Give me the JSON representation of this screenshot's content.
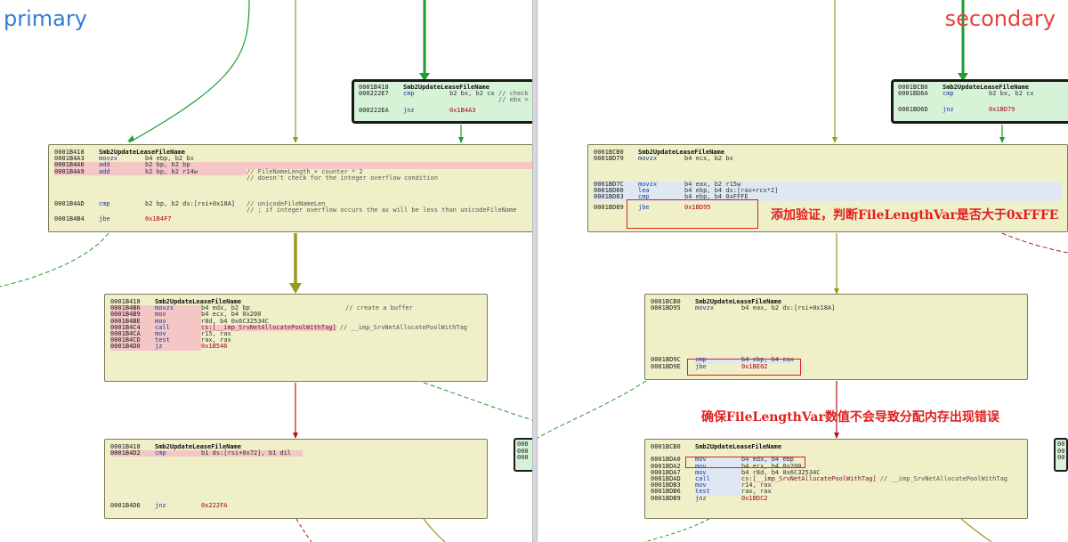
{
  "labels": {
    "primary": "primary",
    "secondary": "secondary"
  },
  "primary": {
    "block_top": {
      "header_addr": "0001B418",
      "header_name": "Smb2UpdateLeaseFileName",
      "rows": [
        {
          "addr": "000222E7",
          "mn": "cmp",
          "ops": "b2 bx, b2 cx",
          "cm": "// check"
        },
        {
          "addr": "",
          "mn": "",
          "ops": "",
          "cm": "// ebx ="
        },
        {
          "addr": "000222EA",
          "mn": "jnz",
          "ops": "0x1B4A3",
          "cm": ""
        }
      ]
    },
    "block_a": {
      "header_addr": "0001B418",
      "header_name": "Smb2UpdateLeaseFileName",
      "rows": [
        {
          "addr": "0001B4A3",
          "mn": "movzx",
          "ops": "b4 ebp, b2 bx",
          "cm": ""
        },
        {
          "addr": "0001B4A6",
          "mn": "add",
          "ops": "b2 bp, b2 bp",
          "cm": ""
        },
        {
          "addr": "0001B4A9",
          "mn": "add",
          "ops": "b2 bp, b2 r14w",
          "cm": "// FileNameLength + counter * 2"
        },
        {
          "addr": "",
          "mn": "",
          "ops": "",
          "cm": "// doesn't check for the integer overflow condition"
        },
        {
          "addr": "0001B4AD",
          "mn": "cmp",
          "ops": "b2 bp, b2 ds:[rsi+0x18A]",
          "cm": "// unicodeFileNameLen"
        },
        {
          "addr": "",
          "mn": "",
          "ops": "",
          "cm": "// ; if integer overflow occurs the ax will be less than unicodeFileName"
        },
        {
          "addr": "0001B4B4",
          "mn": "jbe",
          "ops": "0x1B4F7",
          "cm": ""
        }
      ]
    },
    "block_b": {
      "header_addr": "0001B418",
      "header_name": "Smb2UpdateLeaseFileName",
      "rows": [
        {
          "addr": "0001B4B6",
          "mn": "movzx",
          "ops": "b4 edx, b2 bp",
          "cm": "// create a buffer"
        },
        {
          "addr": "0001B4B9",
          "mn": "mov",
          "ops": "b4 ecx, b4 0x200",
          "cm": ""
        },
        {
          "addr": "0001B4BE",
          "mn": "mov",
          "ops": "r8d, b4 0x6C32534C",
          "cm": ""
        },
        {
          "addr": "0001B4C4",
          "mn": "call",
          "ops": "cs:[__imp_SrvNetAllocatePoolWithTag]",
          "cm": "// __imp_SrvNetAllocatePoolWithTag"
        },
        {
          "addr": "0001B4CA",
          "mn": "mov",
          "ops": "r15, rax",
          "cm": ""
        },
        {
          "addr": "0001B4CD",
          "mn": "test",
          "ops": "rax, rax",
          "cm": ""
        },
        {
          "addr": "0001B4D0",
          "mn": "jz",
          "ops": "0x1B546",
          "cm": ""
        }
      ]
    },
    "block_c": {
      "header_addr": "0001B418",
      "header_name": "Smb2UpdateLeaseFileName",
      "rows": [
        {
          "addr": "0001B4D2",
          "mn": "cmp",
          "ops": "b1 ds:[rsi+0x72], b1 dil",
          "cm": ""
        },
        {
          "addr": "0001B4D6",
          "mn": "jnz",
          "ops": "0x222FA",
          "cm": ""
        }
      ]
    },
    "side_block": {
      "line1": "000",
      "line2": "000",
      "line3": "000"
    }
  },
  "secondary": {
    "block_top": {
      "header_addr": "0001BCB0",
      "header_name": "Smb2UpdateLeaseFileName",
      "rows": [
        {
          "addr": "0001BD6A",
          "mn": "cmp",
          "ops": "b2 bx, b2 cx",
          "cm": ""
        },
        {
          "addr": "0001BD6D",
          "mn": "jnz",
          "ops": "0x1BD79",
          "cm": ""
        }
      ]
    },
    "block_a": {
      "header_addr": "0001BCB0",
      "header_name": "Smb2UpdateLeaseFileName",
      "rows": [
        {
          "addr": "0001BD79",
          "mn": "movzx",
          "ops": "b4 ecx, b2 bx",
          "cm": ""
        },
        {
          "addr": "0001BD7C",
          "mn": "movzx",
          "ops": "b4 eax, b2 r15w",
          "cm": ""
        },
        {
          "addr": "0001BD80",
          "mn": "lea",
          "ops": "b4 ebp, b4 ds:[rax+rcx*2]",
          "cm": ""
        },
        {
          "addr": "0001BD83",
          "mn": "cmp",
          "ops": "b4 ebp, b4 0xFFFE",
          "cm": ""
        },
        {
          "addr": "0001BD89",
          "mn": "jbe",
          "ops": "0x1BD95",
          "cm": ""
        }
      ]
    },
    "block_b": {
      "header_addr": "0001BCB0",
      "header_name": "Smb2UpdateLeaseFileName",
      "rows": [
        {
          "addr": "0001BD95",
          "mn": "movzx",
          "ops": "b4 eax, b2 ds:[rsi+0x18A]",
          "cm": ""
        },
        {
          "addr": "0001BD9C",
          "mn": "cmp",
          "ops": "b4 ebp, b4 eax",
          "cm": ""
        },
        {
          "addr": "0001BD9E",
          "mn": "jbe",
          "ops": "0x1BE02",
          "cm": ""
        }
      ]
    },
    "block_c": {
      "header_addr": "0001BCB0",
      "header_name": "Smb2UpdateLeaseFileName",
      "rows": [
        {
          "addr": "0001BDA0",
          "mn": "mov",
          "ops": "b4 edx, b4 ebp",
          "cm": ""
        },
        {
          "addr": "0001BDA2",
          "mn": "mov",
          "ops": "b4 ecx, b4 0x200",
          "cm": ""
        },
        {
          "addr": "0001BDA7",
          "mn": "mov",
          "ops": "b4 r8d, b4 0x6C32534C",
          "cm": ""
        },
        {
          "addr": "0001BDAD",
          "mn": "call",
          "ops": "cs:[__imp_SrvNetAllocatePoolWithTag]",
          "cm": "// __imp_SrvNetAllocatePoolWithTag"
        },
        {
          "addr": "0001BDB3",
          "mn": "mov",
          "ops": "r14, rax",
          "cm": ""
        },
        {
          "addr": "0001BDB6",
          "mn": "test",
          "ops": "rax, rax",
          "cm": ""
        },
        {
          "addr": "0001BDB9",
          "mn": "jnz",
          "ops": "0x1BDC2",
          "cm": ""
        }
      ]
    },
    "side_block": {
      "line1": "00",
      "line2": "00",
      "line3": "00"
    },
    "annotation_1": "添加验证，判断FileLengthVar是否大于0xFFFE",
    "annotation_2": "确保FileLengthVar数值不会导致分配内存出现错误"
  },
  "colors": {
    "primary_label": "#2f7fd6",
    "secondary_label": "#e2443c",
    "block_fill": "#efefc8",
    "entry_block_fill": "#d6f3d8",
    "edge_green": "#1e9e2e",
    "edge_olive": "#9a9a1e",
    "edge_red": "#b01818",
    "annotation_red": "#e02020"
  }
}
